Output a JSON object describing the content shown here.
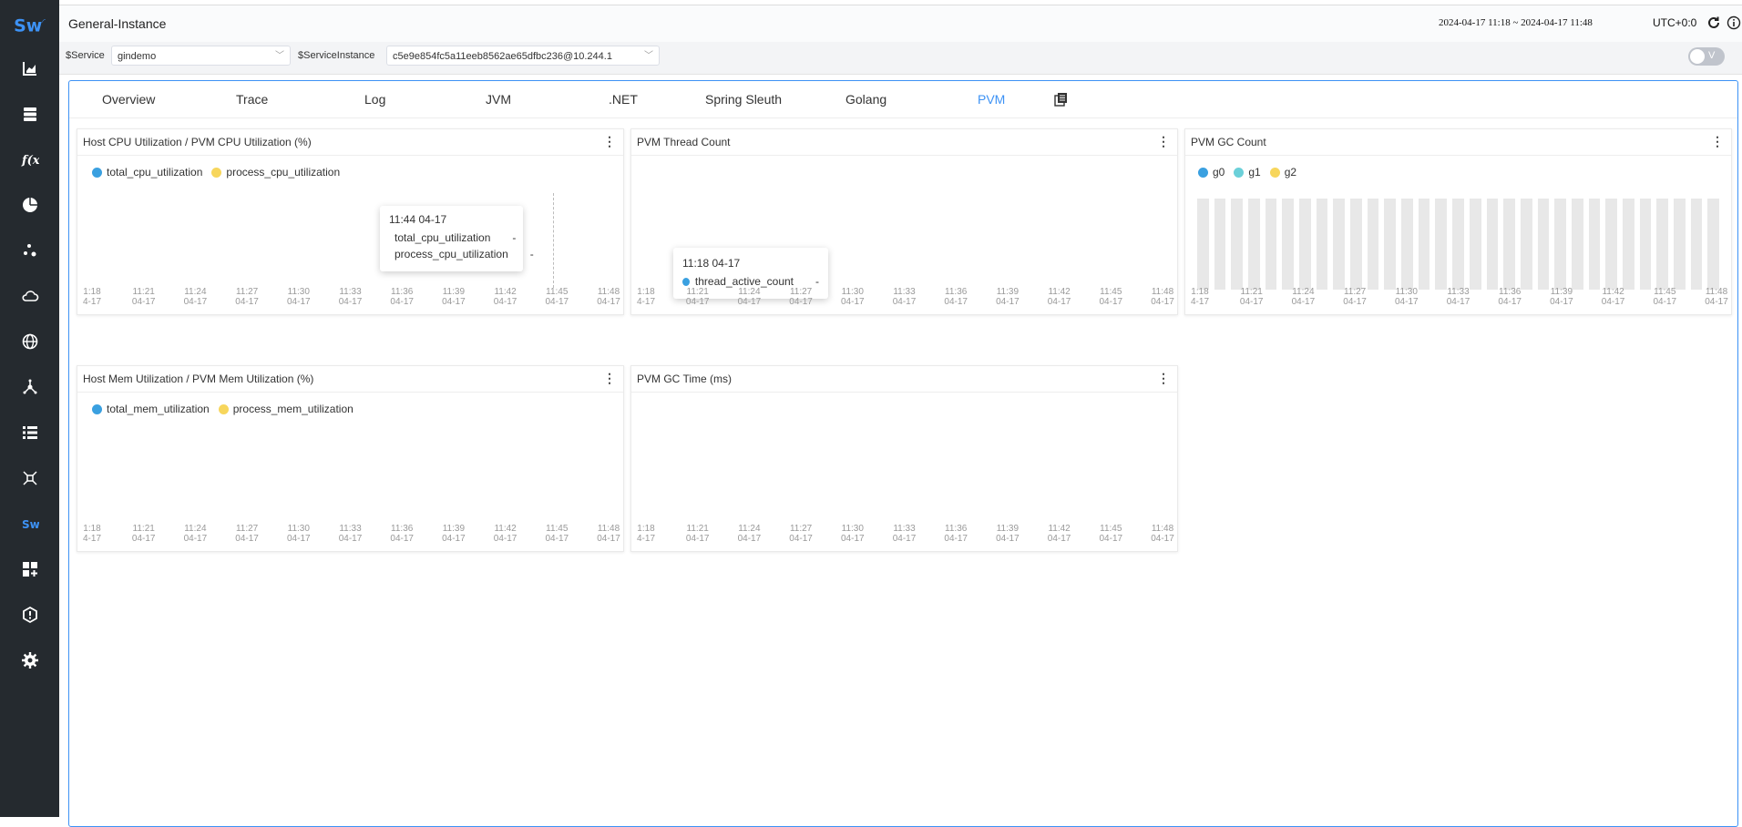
{
  "sidebar": {
    "logo": "Sw",
    "items": [
      {
        "icon": "chart-icon"
      },
      {
        "icon": "database-icon"
      },
      {
        "icon": "function-icon"
      },
      {
        "icon": "pie-icon"
      },
      {
        "icon": "dots-icon"
      },
      {
        "icon": "cloud-icon"
      },
      {
        "icon": "globe-icon"
      },
      {
        "icon": "mesh-icon"
      },
      {
        "icon": "list-icon"
      },
      {
        "icon": "network-icon"
      },
      {
        "icon": "sw-icon"
      },
      {
        "icon": "dashboard-add-icon"
      },
      {
        "icon": "shield-icon"
      },
      {
        "icon": "settings-icon"
      }
    ]
  },
  "header": {
    "title": "General-Instance",
    "time_range": "2024-04-17 11:18 ~ 2024-04-17 11:48",
    "timezone": "UTC+0:0"
  },
  "selectors": {
    "service_label": "$Service",
    "service_value": "gindemo",
    "instance_label": "$ServiceInstance",
    "instance_value": "c5e9e854fc5a11eeb8562ae65dfbc236@10.244.1",
    "toggle_label": "V"
  },
  "tabs": [
    "Overview",
    "Trace",
    "Log",
    "JVM",
    ".NET",
    "Spring Sleuth",
    "Golang",
    "PVM"
  ],
  "active_tab": "PVM",
  "x_ticks": [
    {
      "time": "1:18",
      "date": "4-17"
    },
    {
      "time": "11:21",
      "date": "04-17"
    },
    {
      "time": "11:24",
      "date": "04-17"
    },
    {
      "time": "11:27",
      "date": "04-17"
    },
    {
      "time": "11:30",
      "date": "04-17"
    },
    {
      "time": "11:33",
      "date": "04-17"
    },
    {
      "time": "11:36",
      "date": "04-17"
    },
    {
      "time": "11:39",
      "date": "04-17"
    },
    {
      "time": "11:42",
      "date": "04-17"
    },
    {
      "time": "11:45",
      "date": "04-17"
    },
    {
      "time": "11:48",
      "date": "04-17"
    }
  ],
  "panels": {
    "cpu": {
      "title": "Host CPU Utilization / PVM CPU Utilization (%)",
      "legend": [
        {
          "name": "total_cpu_utilization",
          "color": "#3aa0e0"
        },
        {
          "name": "process_cpu_utilization",
          "color": "#f7d65c"
        }
      ],
      "tooltip": {
        "title": "11:44 04-17",
        "rows": [
          {
            "name": "total_cpu_utilization",
            "color": "#3aa0e0",
            "value": "-"
          },
          {
            "name": "process_cpu_utilization",
            "color": "#f7d65c",
            "value": "-"
          }
        ]
      }
    },
    "thread": {
      "title": "PVM Thread Count",
      "tooltip": {
        "title": "11:18 04-17",
        "rows": [
          {
            "name": "thread_active_count",
            "color": "#3aa0e0",
            "value": "-"
          }
        ]
      }
    },
    "gc_count": {
      "title": "PVM GC Count",
      "legend": [
        {
          "name": "g0",
          "color": "#3aa0e0"
        },
        {
          "name": "g1",
          "color": "#6bd0d9"
        },
        {
          "name": "g2",
          "color": "#f7d65c"
        }
      ]
    },
    "mem": {
      "title": "Host Mem Utilization / PVM Mem Utilization (%)",
      "legend": [
        {
          "name": "total_mem_utilization",
          "color": "#3aa0e0"
        },
        {
          "name": "process_mem_utilization",
          "color": "#f7d65c"
        }
      ]
    },
    "gc_time": {
      "title": "PVM GC Time (ms)"
    }
  },
  "menu_glyph": "⋮"
}
